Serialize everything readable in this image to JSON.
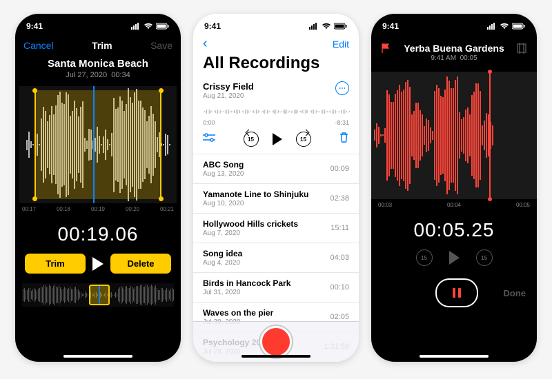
{
  "status": {
    "time": "9:41"
  },
  "trim": {
    "cancel": "Cancel",
    "title": "Trim",
    "save": "Save",
    "name": "Santa Monica Beach",
    "date": "Jul 27, 2020",
    "length": "00:34",
    "ruler": [
      "00:17",
      "00:18",
      "00:19",
      "00:20",
      "00:21"
    ],
    "time": "00:19.06",
    "trim_btn": "Trim",
    "delete_btn": "Delete"
  },
  "list": {
    "edit": "Edit",
    "title": "All Recordings",
    "current": {
      "title": "Crissy Field",
      "date": "Aug 21, 2020",
      "start": "0:00",
      "end": "-8:31"
    },
    "skip": "15",
    "rows": [
      {
        "title": "ABC Song",
        "date": "Aug 13, 2020",
        "dur": "00:09"
      },
      {
        "title": "Yamanote Line to Shinjuku",
        "date": "Aug 10, 2020",
        "dur": "02:38"
      },
      {
        "title": "Hollywood Hills crickets",
        "date": "Aug 7, 2020",
        "dur": "15:11"
      },
      {
        "title": "Song idea",
        "date": "Aug 4, 2020",
        "dur": "04:03"
      },
      {
        "title": "Birds in Hancock Park",
        "date": "Jul 31, 2020",
        "dur": "00:10"
      },
      {
        "title": "Waves on the pier",
        "date": "Jul 30, 2020",
        "dur": "02:05"
      },
      {
        "title": "Psychology 201",
        "date": "Jul 28, 2020",
        "dur": "1:31:58"
      }
    ]
  },
  "rec": {
    "name": "Yerba Buena Gardens",
    "time_label": "9:41 AM",
    "length": "00:05",
    "ruler": [
      "00:03",
      "00:04",
      "00:05"
    ],
    "time": "00:05.25",
    "skip": "15",
    "done": "Done"
  }
}
